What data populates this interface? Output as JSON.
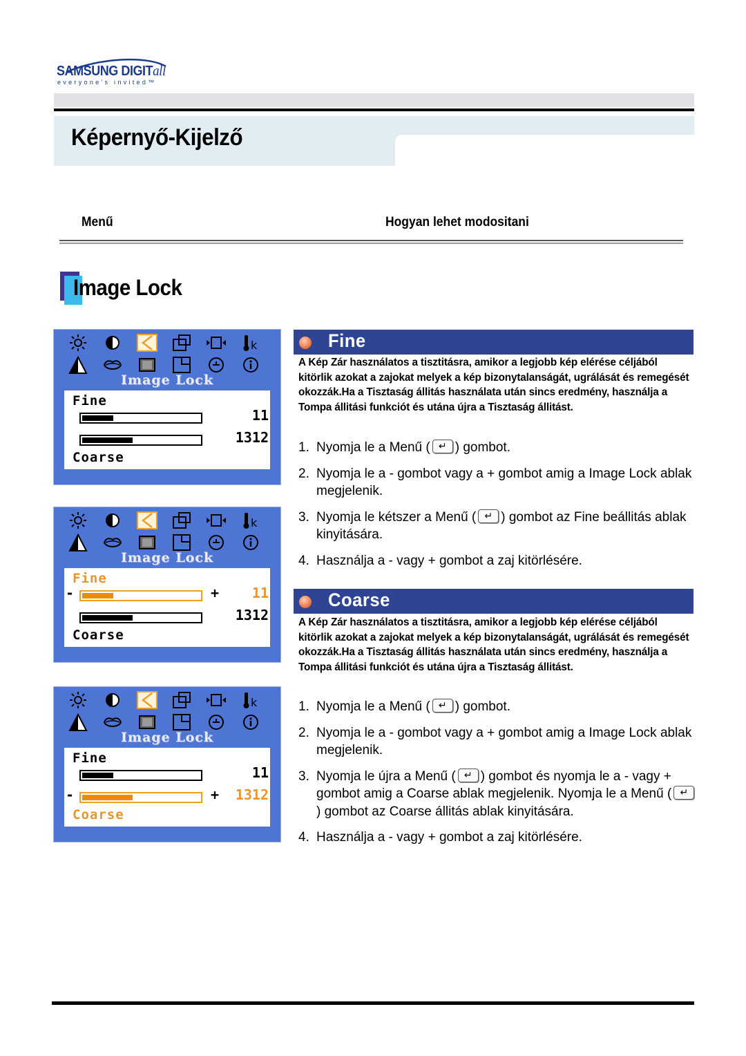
{
  "logo": {
    "brand": "SAMSUNG DIGIT",
    "brand_suffix": "all",
    "tagline": "everyone's invited™"
  },
  "page_title": "Képernyő-Kijelző",
  "columns": {
    "menu": "Menű",
    "how": "Hogyan lehet modositani"
  },
  "section_title": "Image Lock",
  "osd_panels": [
    {
      "title": "Image Lock",
      "fine_label": "Fine",
      "coarse_label": "Coarse",
      "fine_value": "11",
      "coarse_value": "1312",
      "fine_fill_pct": 26,
      "coarse_fill_pct": 42,
      "active": "none",
      "minus": "-",
      "plus": "+"
    },
    {
      "title": "Image Lock",
      "fine_label": "Fine",
      "coarse_label": "Coarse",
      "fine_value": "11",
      "coarse_value": "1312",
      "fine_fill_pct": 26,
      "coarse_fill_pct": 42,
      "active": "fine",
      "minus": "-",
      "plus": "+"
    },
    {
      "title": "Image Lock",
      "fine_label": "Fine",
      "coarse_label": "Coarse",
      "fine_value": "11",
      "coarse_value": "1312",
      "fine_fill_pct": 26,
      "coarse_fill_pct": 42,
      "active": "coarse",
      "minus": "-",
      "plus": "+"
    }
  ],
  "osd_icons": [
    "brightness-icon",
    "contrast-icon",
    "image-lock-icon",
    "position-icon",
    "size-icon",
    "color-temp-icon",
    "sharpness-icon",
    "color-icon",
    "moire-icon",
    "menu-position-icon",
    "recall-icon",
    "information-icon"
  ],
  "fine": {
    "heading": "Fine",
    "description": "A Kép Zár használatos a tisztitásra, amikor a legjobb kép elérése céljából kitörlik azokat a zajokat melyek a kép bizonytalanságát, ugrálását és remegését okozzák.Ha a Tisztaság állitás használata után sincs eredmény, használja a Tompa állitási funkciót és utána újra a Tisztaság állitást.",
    "steps": [
      {
        "num": "1.",
        "pre": "Nyomja le a Menű  (",
        "post": ") gombot.",
        "key": true
      },
      {
        "num": "2.",
        "pre": "Nyomja le a - gombot vagy a + gombot amig a Image Lock ablak megjelenik.",
        "post": "",
        "key": false
      },
      {
        "num": "3.",
        "pre": "Nyomja le kétszer a Menű (",
        "post": ") gombot az Fine beállitás ablak kinyitására.",
        "key": true
      },
      {
        "num": "4.",
        "pre": "Használja a - vagy + gombot a zaj kitörlésére.",
        "post": "",
        "key": false
      }
    ]
  },
  "coarse": {
    "heading": "Coarse",
    "description": "A Kép Zár használatos a tisztitásra, amikor a legjobb kép elérése céljából kitörlik azokat a zajokat melyek a kép bizonytalanságát, ugrálását és remegését okozzák.Ha a Tisztaság állitás használata után sincs eredmény, használja a Tompa állitási funkciót és utána újra a Tisztaság állitást.",
    "steps": [
      {
        "num": "1.",
        "pre": "Nyomja le a Menű  (",
        "post": ") gombot.",
        "key": true
      },
      {
        "num": "2.",
        "pre": "Nyomja le a - gombot vagy a + gombot amig a Image Lock ablak megjelenik.",
        "post": "",
        "key": false
      },
      {
        "num": "3.",
        "pre": "Nyomja le újra a Menű (",
        "mid": ") gombot és nyomja le a - vagy + gombot amig a Coarse ablak megjelenik. Nyomja le a Menű (",
        "post": ")  gombot az Coarse állitás ablak kinyitására.",
        "key": true,
        "key2": true
      },
      {
        "num": "4.",
        "pre": "Használja a - vagy + gombot a zaj kitörlésére.",
        "post": "",
        "key": false
      }
    ]
  },
  "colors": {
    "osd_blue": "#4e74d4",
    "section_blue": "#2f4593",
    "highlight_orange": "#f28a00",
    "title_band": "#e1ecf3"
  }
}
